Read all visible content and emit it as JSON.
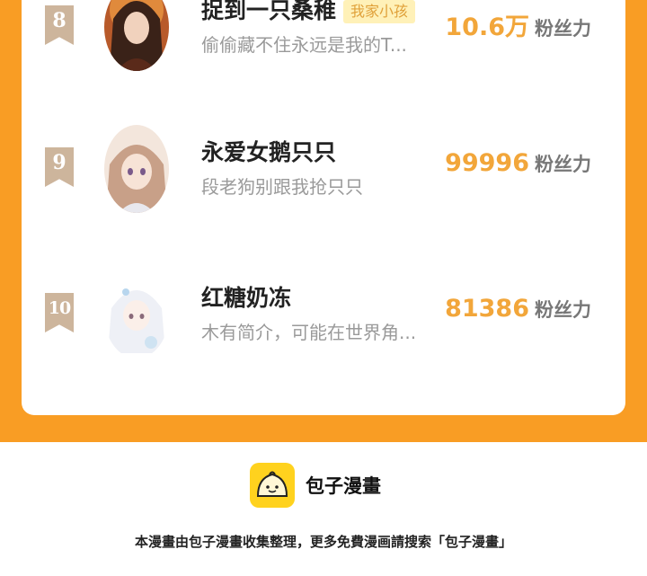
{
  "ranking": {
    "fans_label": "粉丝力",
    "items": [
      {
        "rank": "8",
        "name": "捉到一只桑稚",
        "tag": "我家小孩",
        "intro": "偷偷藏不住永远是我的T...",
        "fans": "10.6万"
      },
      {
        "rank": "9",
        "name": "永爱女鹅只只",
        "tag": "",
        "intro": "段老狗别跟我抢只只",
        "fans": "99996"
      },
      {
        "rank": "10",
        "name": "红糖奶冻",
        "tag": "",
        "intro": "木有简介，可能在世界角...",
        "fans": "81386"
      }
    ]
  },
  "footer": {
    "brand": "包子漫畫",
    "note": "本漫畫由包子漫畫收集整理，更多免費漫画請搜索「包子漫畫」"
  },
  "colors": {
    "background_band": "#f99d24",
    "fans_value": "#f2a63a",
    "rank_badge": "#cdb59c",
    "logo": "#ffd21e"
  }
}
